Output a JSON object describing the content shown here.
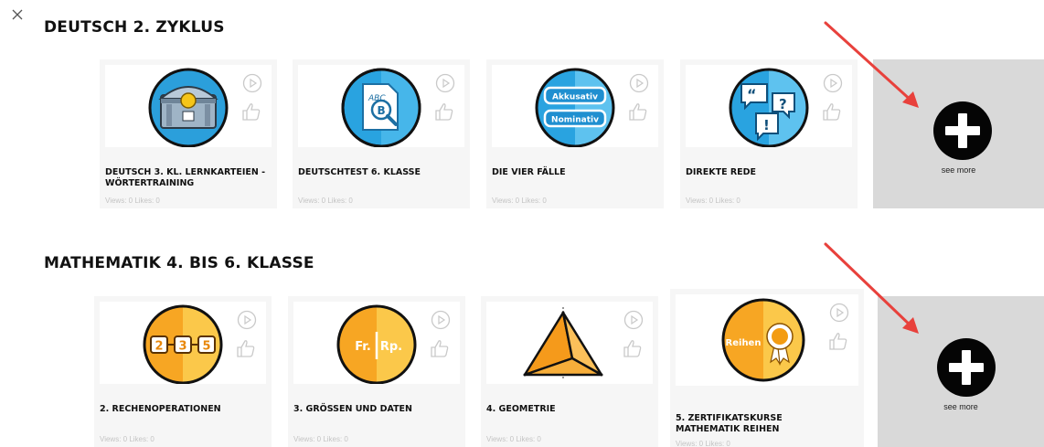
{
  "window": {
    "close_icon": "close-icon"
  },
  "sections": [
    {
      "title": "DEUTSCH 2. ZYKLUS",
      "cards": [
        {
          "title": "DEUTSCH 3. KL. LERNKARTEIEN - WÖRTERTRAINING",
          "stats": "Views: 0 Likes: 0",
          "icon": "treasure-chest-icon"
        },
        {
          "title": "DEUTSCHTEST 6. KLASSE",
          "stats": "Views: 0 Likes: 0",
          "icon": "abc-document-search-icon"
        },
        {
          "title": "DIE VIER FÄLLE",
          "stats": "Views: 0 Likes: 0",
          "icon": "grammar-cases-icon",
          "badges": [
            "Akkusativ",
            "Nominativ"
          ]
        },
        {
          "title": "DIREKTE REDE",
          "stats": "Views: 0 Likes: 0",
          "icon": "speech-bubbles-icon"
        }
      ],
      "see_more": "see more"
    },
    {
      "title": "MATHEMATIK 4. BIS 6. KLASSE",
      "cards": [
        {
          "title": "2. RECHENOPERATIONEN",
          "stats": "Views: 0 Likes: 0",
          "icon": "number-blocks-icon",
          "digits": [
            "2",
            "3",
            "5"
          ]
        },
        {
          "title": "3. GRÖSSEN UND DATEN",
          "stats": "Views: 0 Likes: 0",
          "icon": "currency-icon",
          "left": "Fr.",
          "right": "Rp."
        },
        {
          "title": "4. GEOMETRIE",
          "stats": "Views: 0 Likes: 0",
          "icon": "pyramid-icon"
        },
        {
          "title": "5. ZERTIFIKATSKURSE MATHEMATIK REIHEN",
          "stats": "Views: 0 Likes: 0",
          "icon": "award-ribbon-icon",
          "badge_text": "Reihen"
        }
      ],
      "see_more": "see more"
    }
  ],
  "colors": {
    "deutsch_blue": "#29a3e0",
    "deutsch_light": "#8fd3f4",
    "math_orange": "#f7a623",
    "math_light": "#fbc84a",
    "annotation_red": "#e8413c",
    "see_more_bg": "#d9d9d9"
  }
}
